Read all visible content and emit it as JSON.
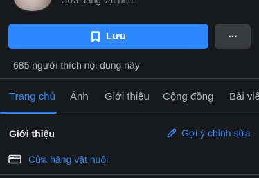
{
  "profile": {
    "category_partial": "Cửa hàng vật nuôi"
  },
  "actions": {
    "save_label": "Lưu",
    "more_label": "..."
  },
  "likes_text": "685 người thích nội dung này",
  "tabs": [
    {
      "label": "Trang chủ",
      "active": true
    },
    {
      "label": "Ảnh",
      "active": false
    },
    {
      "label": "Giới thiệu",
      "active": false
    },
    {
      "label": "Cộng đồng",
      "active": false
    },
    {
      "label": "Bài viết",
      "active": false
    }
  ],
  "about": {
    "title": "Giới thiệu",
    "suggest_edit": "Gợi ý chỉnh sửa",
    "category": "Cửa hàng vật nuôi"
  },
  "colors": {
    "background": "#18191a",
    "accent": "#2d88ff",
    "secondary_button": "#3a3b3c",
    "text_primary": "#e4e6eb",
    "text_secondary": "#b0b3b8"
  },
  "icons": {
    "save": "bookmark-icon",
    "more": "more-dots-icon",
    "edit": "pencil-icon",
    "category": "flag-icon"
  }
}
